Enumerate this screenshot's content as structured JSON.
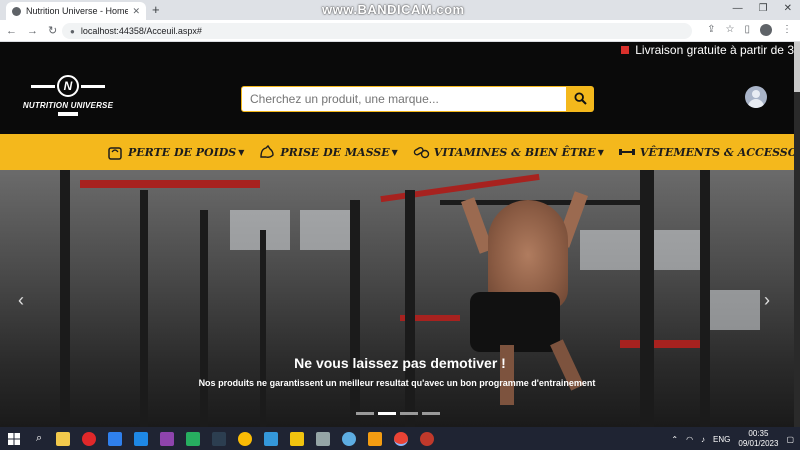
{
  "browser": {
    "tab_title": "Nutrition Universe - Home of Bo",
    "tab_close": "✕",
    "new_tab": "+",
    "url": "localhost:44358/Acceuil.aspx#",
    "watermark": "www.BANDICAM.com",
    "nav_back": "←",
    "nav_forward": "→",
    "nav_reload": "↻",
    "win_min": "—",
    "win_max": "❐",
    "win_close": "✕"
  },
  "header": {
    "promo_text": "Livraison gratuite à partir de 3",
    "logo_letter": "N",
    "logo_name": "NUTRITION UNIVERSE",
    "search_placeholder": "Cherchez un produit, une marque..."
  },
  "categories": [
    {
      "label": "PERTE DE POIDS",
      "icon": "scale-icon"
    },
    {
      "label": "PRISE DE MASSE",
      "icon": "muscle-arm-icon"
    },
    {
      "label": "VITAMINES & BIEN ÊTRE",
      "icon": "pills-icon"
    },
    {
      "label": "VÊTEMENTS & ACCESSOIRES",
      "icon": "dumbbell-icon"
    }
  ],
  "hero": {
    "title": "Ne vous laissez pas demotiver !",
    "subtitle": "Nos produits ne garantissent un meilleur resultat qu'avec un bon programme d'entrainement",
    "prev": "‹",
    "next": "›",
    "slide_count": 4,
    "active_slide": 2
  },
  "taskbar": {
    "lang": "ENG",
    "time": "00:35",
    "date": "09/01/2023"
  },
  "colors": {
    "accent": "#f4b81c",
    "header_bg": "#0a0a0a",
    "promo_icon": "#d9302b"
  }
}
